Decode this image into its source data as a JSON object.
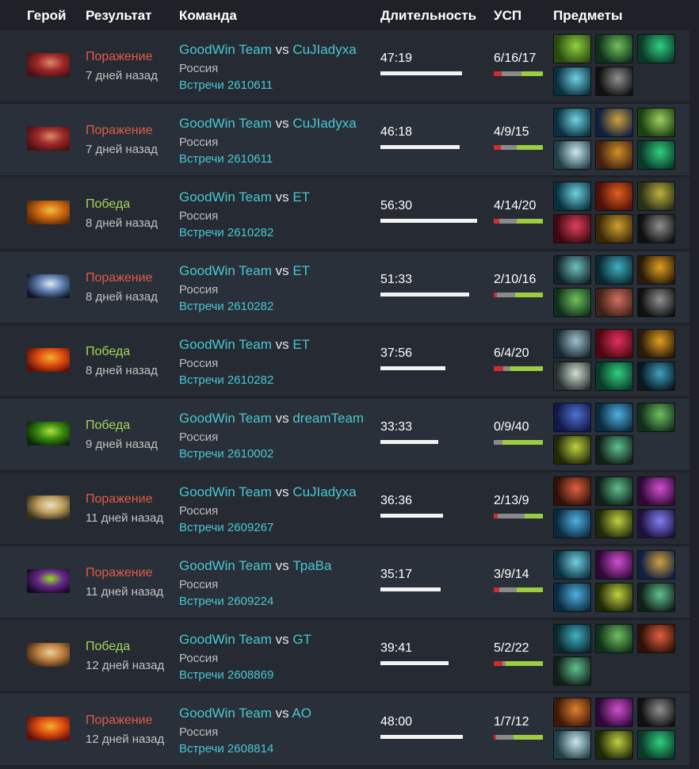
{
  "header": {
    "hero": "Герой",
    "result": "Результат",
    "team": "Команда",
    "duration": "Длительность",
    "kda": "УСП",
    "items": "Предметы"
  },
  "colors": {
    "loss": "#e05a47",
    "win": "#a5d65b",
    "link": "#48c7d2"
  },
  "max_duration_minutes": 60,
  "matches": [
    {
      "hero_icon": "hero-portrait-red-beast-icon",
      "hero_colors": [
        "#4a1010",
        "#a02a2a",
        "#d88a6a"
      ],
      "outcome": "loss",
      "result": "Поражение",
      "when": "7 дней назад",
      "team_a": "GoodWin Team",
      "vs": "vs",
      "team_b": "CuJIadyxa",
      "country": "Россия",
      "series": "Встречи 2610611",
      "duration": "47:19",
      "duration_min": 47.32,
      "kda": "6/16/17",
      "k": 6,
      "d": 16,
      "a": 17,
      "items": [
        {
          "icon": "blade-item-icon",
          "colors": [
            "#2a4a10",
            "#8fd040"
          ]
        },
        {
          "icon": "wand-item-icon",
          "colors": [
            "#10301a",
            "#70c060"
          ]
        },
        {
          "icon": "boots-item-icon",
          "colors": [
            "#0a3a28",
            "#30d080"
          ]
        },
        {
          "icon": "axe-item-icon",
          "colors": [
            "#0a3040",
            "#70d0e0"
          ]
        },
        {
          "icon": "blink-item-icon",
          "colors": [
            "#101010",
            "#909090"
          ]
        }
      ]
    },
    {
      "hero_icon": "hero-portrait-red-beast-icon",
      "hero_colors": [
        "#4a1010",
        "#a02a2a",
        "#d88a6a"
      ],
      "outcome": "loss",
      "result": "Поражение",
      "when": "7 дней назад",
      "team_a": "GoodWin Team",
      "vs": "vs",
      "team_b": "CuJIadyxa",
      "country": "Россия",
      "series": "Встречи 2610611",
      "duration": "46:18",
      "duration_min": 46.3,
      "kda": "4/9/15",
      "k": 4,
      "d": 9,
      "a": 15,
      "items": [
        {
          "icon": "axe-item-icon",
          "colors": [
            "#0a3040",
            "#70d0e0"
          ]
        },
        {
          "icon": "orb-item-icon",
          "colors": [
            "#102040",
            "#d0a040"
          ]
        },
        {
          "icon": "drum-item-icon",
          "colors": [
            "#1a4010",
            "#a0d060"
          ]
        },
        {
          "icon": "scroll-item-icon",
          "colors": [
            "#204048",
            "#d0e8f0"
          ]
        },
        {
          "icon": "gem-item-icon",
          "colors": [
            "#402010",
            "#d0902a"
          ]
        },
        {
          "icon": "boots-item-icon",
          "colors": [
            "#0a3a28",
            "#30d080"
          ]
        }
      ]
    },
    {
      "hero_icon": "hero-portrait-golden-warrior-icon",
      "hero_colors": [
        "#5a2a08",
        "#d06a10",
        "#f0c040"
      ],
      "outcome": "win",
      "result": "Победа",
      "when": "8 дней назад",
      "team_a": "GoodWin Team",
      "vs": "vs",
      "team_b": "ET",
      "country": "Россия",
      "series": "Встречи 2610282",
      "duration": "56:30",
      "duration_min": 56.5,
      "kda": "4/14/20",
      "k": 4,
      "d": 14,
      "a": 20,
      "items": [
        {
          "icon": "axe-item-icon",
          "colors": [
            "#0a3040",
            "#70d0e0"
          ]
        },
        {
          "icon": "shield-item-icon",
          "colors": [
            "#501008",
            "#e06020"
          ]
        },
        {
          "icon": "relic-item-icon",
          "colors": [
            "#283018",
            "#c0b040"
          ]
        },
        {
          "icon": "heart-item-icon",
          "colors": [
            "#400810",
            "#e04060"
          ]
        },
        {
          "icon": "pedestal-item-icon",
          "colors": [
            "#3a2808",
            "#d0a030"
          ]
        },
        {
          "icon": "blink-item-icon",
          "colors": [
            "#101010",
            "#909090"
          ]
        }
      ]
    },
    {
      "hero_icon": "hero-portrait-dark-sorceress-icon",
      "hero_colors": [
        "#101828",
        "#6080b0",
        "#e0e8f0"
      ],
      "outcome": "loss",
      "result": "Поражение",
      "when": "8 дней назад",
      "team_a": "GoodWin Team",
      "vs": "vs",
      "team_b": "ET",
      "country": "Россия",
      "series": "Встречи 2610282",
      "duration": "51:33",
      "duration_min": 51.55,
      "kda": "2/10/16",
      "k": 2,
      "d": 10,
      "a": 16,
      "items": [
        {
          "icon": "armor-item-icon",
          "colors": [
            "#102428",
            "#70c0c0"
          ]
        },
        {
          "icon": "greaves-item-icon",
          "colors": [
            "#0a2830",
            "#40b0c0"
          ]
        },
        {
          "icon": "claw-item-icon",
          "colors": [
            "#2a1a08",
            "#e0a020"
          ]
        },
        {
          "icon": "wand-item-icon",
          "colors": [
            "#10301a",
            "#70c060"
          ]
        },
        {
          "icon": "hammer-item-icon",
          "colors": [
            "#402018",
            "#d07060"
          ]
        },
        {
          "icon": "blink-item-icon",
          "colors": [
            "#101010",
            "#909090"
          ]
        }
      ]
    },
    {
      "hero_icon": "hero-portrait-phoenix-icon",
      "hero_colors": [
        "#601008",
        "#e05010",
        "#f0b030"
      ],
      "outcome": "win",
      "result": "Победа",
      "when": "8 дней назад",
      "team_a": "GoodWin Team",
      "vs": "vs",
      "team_b": "ET",
      "country": "Россия",
      "series": "Встречи 2610282",
      "duration": "37:56",
      "duration_min": 37.93,
      "kda": "6/4/20",
      "k": 6,
      "d": 4,
      "a": 20,
      "items": [
        {
          "icon": "skull-item-icon",
          "colors": [
            "#182830",
            "#a0c0d0"
          ]
        },
        {
          "icon": "ruby-item-icon",
          "colors": [
            "#500810",
            "#e03060"
          ]
        },
        {
          "icon": "claw-item-icon",
          "colors": [
            "#2a1a08",
            "#e0a020"
          ]
        },
        {
          "icon": "feather-item-icon",
          "colors": [
            "#283030",
            "#d0e0d0"
          ]
        },
        {
          "icon": "boots-item-icon",
          "colors": [
            "#0a3a28",
            "#30d080"
          ]
        },
        {
          "icon": "scythe-item-icon",
          "colors": [
            "#081820",
            "#40a0c0"
          ]
        }
      ]
    },
    {
      "hero_icon": "hero-portrait-green-demon-icon",
      "hero_colors": [
        "#0a2808",
        "#3a8a10",
        "#b0e040"
      ],
      "outcome": "win",
      "result": "Победа",
      "when": "9 дней назад",
      "team_a": "GoodWin Team",
      "vs": "vs",
      "team_b": "dreamTeam",
      "country": "Россия",
      "series": "Встречи 2610002",
      "duration": "33:33",
      "duration_min": 33.55,
      "kda": "0/9/40",
      "k": 0,
      "d": 9,
      "a": 40,
      "items": [
        {
          "icon": "cape-item-icon",
          "colors": [
            "#101848",
            "#5070d0"
          ]
        },
        {
          "icon": "lantern-item-icon",
          "colors": [
            "#0a2a40",
            "#50b0e0"
          ]
        },
        {
          "icon": "wand-item-icon",
          "colors": [
            "#10301a",
            "#70c060"
          ]
        },
        {
          "icon": "gauntlet-item-icon",
          "colors": [
            "#202808",
            "#c0d040"
          ]
        },
        {
          "icon": "staff-item-icon",
          "colors": [
            "#102018",
            "#60c090"
          ]
        }
      ]
    },
    {
      "hero_icon": "hero-portrait-paladin-icon",
      "hero_colors": [
        "#3a3018",
        "#c0a060",
        "#e8e0c0"
      ],
      "outcome": "loss",
      "result": "Поражение",
      "when": "11 дней назад",
      "team_a": "GoodWin Team",
      "vs": "vs",
      "team_b": "CuJIadyxa",
      "country": "Россия",
      "series": "Встречи 2609267",
      "duration": "36:36",
      "duration_min": 36.6,
      "kda": "2/13/9",
      "k": 2,
      "d": 13,
      "a": 9,
      "items": [
        {
          "icon": "potion-item-icon",
          "colors": [
            "#301008",
            "#e06040"
          ]
        },
        {
          "icon": "staff-item-icon",
          "colors": [
            "#102018",
            "#60c090"
          ]
        },
        {
          "icon": "orb-item-icon",
          "colors": [
            "#300838",
            "#d050d0"
          ]
        },
        {
          "icon": "lantern-item-icon",
          "colors": [
            "#0a2a40",
            "#50b0e0"
          ]
        },
        {
          "icon": "gauntlet-item-icon",
          "colors": [
            "#202808",
            "#c0d040"
          ]
        },
        {
          "icon": "crystal-item-icon",
          "colors": [
            "#201040",
            "#8080f0"
          ]
        }
      ]
    },
    {
      "hero_icon": "hero-portrait-venom-icon",
      "hero_colors": [
        "#180828",
        "#6a2a8a",
        "#90e020"
      ],
      "outcome": "loss",
      "result": "Поражение",
      "when": "11 дней назад",
      "team_a": "GoodWin Team",
      "vs": "vs",
      "team_b": "ТраВа",
      "country": "Россия",
      "series": "Встречи 2609224",
      "duration": "35:17",
      "duration_min": 35.28,
      "kda": "3/9/14",
      "k": 3,
      "d": 9,
      "a": 14,
      "items": [
        {
          "icon": "axe-item-icon",
          "colors": [
            "#0a3040",
            "#70d0e0"
          ]
        },
        {
          "icon": "orb-item-icon",
          "colors": [
            "#300838",
            "#d050d0"
          ]
        },
        {
          "icon": "globe-item-icon",
          "colors": [
            "#102040",
            "#d0a040"
          ]
        },
        {
          "icon": "lantern-item-icon",
          "colors": [
            "#0a2a40",
            "#50b0e0"
          ]
        },
        {
          "icon": "gauntlet-item-icon",
          "colors": [
            "#202808",
            "#c0d040"
          ]
        },
        {
          "icon": "staff-item-icon",
          "colors": [
            "#102018",
            "#60c090"
          ]
        }
      ]
    },
    {
      "hero_icon": "hero-portrait-monkey-icon",
      "hero_colors": [
        "#3a2818",
        "#c08040",
        "#e8d0a0"
      ],
      "outcome": "win",
      "result": "Победа",
      "when": "12 дней назад",
      "team_a": "GoodWin Team",
      "vs": "vs",
      "team_b": "GT",
      "country": "Россия",
      "series": "Встречи 2608869",
      "duration": "39:41",
      "duration_min": 39.68,
      "kda": "5/2/22",
      "k": 5,
      "d": 2,
      "a": 22,
      "items": [
        {
          "icon": "greaves-item-icon",
          "colors": [
            "#0a2830",
            "#40b0c0"
          ]
        },
        {
          "icon": "wand-item-icon",
          "colors": [
            "#10301a",
            "#70c060"
          ]
        },
        {
          "icon": "potion-item-icon",
          "colors": [
            "#301008",
            "#e06040"
          ]
        },
        {
          "icon": "staff-item-icon",
          "colors": [
            "#102018",
            "#60c090"
          ]
        }
      ]
    },
    {
      "hero_icon": "hero-portrait-phoenix-icon",
      "hero_colors": [
        "#601008",
        "#e05010",
        "#f0b030"
      ],
      "outcome": "loss",
      "result": "Поражение",
      "when": "12 дней назад",
      "team_a": "GoodWin Team",
      "vs": "vs",
      "team_b": "AO",
      "country": "Россия",
      "series": "Встречи 2608814",
      "duration": "48:00",
      "duration_min": 48.0,
      "kda": "1/7/12",
      "k": 1,
      "d": 7,
      "a": 12,
      "items": [
        {
          "icon": "lantern-item-icon",
          "colors": [
            "#401808",
            "#e08030"
          ]
        },
        {
          "icon": "hood-item-icon",
          "colors": [
            "#300838",
            "#d050d0"
          ]
        },
        {
          "icon": "blink-item-icon",
          "colors": [
            "#101010",
            "#909090"
          ]
        },
        {
          "icon": "scroll-item-icon",
          "colors": [
            "#204048",
            "#d0e8f0"
          ]
        },
        {
          "icon": "gauntlet-item-icon",
          "colors": [
            "#202808",
            "#c0d040"
          ]
        },
        {
          "icon": "boots-item-icon",
          "colors": [
            "#0a3a28",
            "#30d080"
          ]
        }
      ]
    }
  ]
}
